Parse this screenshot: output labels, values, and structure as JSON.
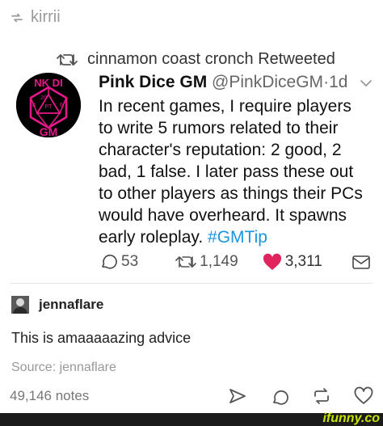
{
  "reblog": {
    "username": "kirrii",
    "icon": "reblog-icon"
  },
  "retweet_note": "cinnamon coast cronch Retweeted",
  "tweet": {
    "name": "Pink Dice GM",
    "handle": "@PinkDiceGM",
    "separator": "·",
    "time": "1d",
    "text": "In recent games, I require players to write 5 rumors related to their character's reputation: 2 good, 2 bad, 1 false. I later pass these out to other players as things their PCs would have overheard. It spawns early roleplay. ",
    "hashtag": "#GMTip",
    "avatar_text": {
      "top": "NK DI",
      "die_numbers": [
        "20",
        "PT",
        "8",
        "6"
      ],
      "bottom": "GM"
    },
    "replies": "53",
    "retweets": "1,149",
    "likes": "3,311"
  },
  "comment": {
    "username": "jennaflare",
    "text": "This is amaaaaazing advice",
    "source": "Source: jennaflare"
  },
  "footer": {
    "notes": "49,146 notes"
  },
  "watermark": "ifunny.co",
  "colors": {
    "accent_pink": "#e8188a",
    "link_blue": "#1b95e0",
    "heart_red": "#e0245e",
    "watermark_green": "#c7e300"
  }
}
